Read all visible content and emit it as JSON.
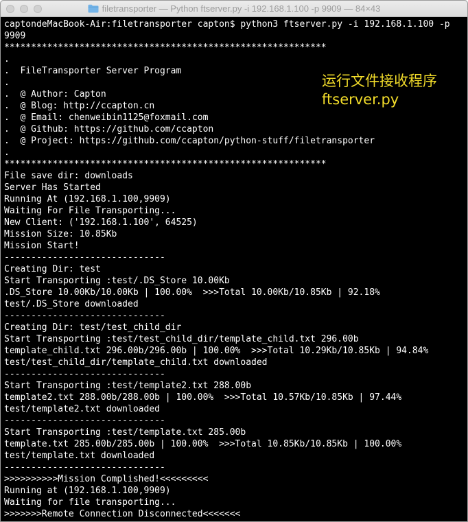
{
  "window": {
    "title": "filetransporter — Python ftserver.py -i 192.168.1.100 -p 9909 — 84×43",
    "colors": {
      "background": "#000000",
      "text": "#ffffff",
      "annotation": "#f2dc2a",
      "titlebar": "#e4e4e4",
      "traffic_inactive": "#d1d1d1",
      "folder_icon": "#74b4e8"
    }
  },
  "terminal": {
    "lines": [
      "captondeMacBook-Air:filetransporter capton$ python3 ftserver.py -i 192.168.1.100 -p",
      "9909",
      "************************************************************",
      ".",
      ".  FileTransporter Server Program",
      ".",
      ".  @ Author: Capton",
      ".  @ Blog: http://ccapton.cn",
      ".  @ Email: chenweibin1125@foxmail.com",
      ".  @ Github: https://github.com/ccapton",
      ".  @ Project: https://github.com/ccapton/python-stuff/filetransporter",
      ".",
      "************************************************************",
      "File save dir: downloads",
      "Server Has Started",
      "Running At (192.168.1.100,9909)",
      "Waiting For File Transporting...",
      "New Client: ('192.168.1.100', 64525)",
      "Mission Size: 10.85Kb",
      "Mission Start!",
      "------------------------------",
      "Creating Dir: test",
      "Start Transporting :test/.DS_Store 10.00Kb",
      ".DS_Store 10.00Kb/10.00Kb | 100.00%  >>>Total 10.00Kb/10.85Kb | 92.18%",
      "test/.DS_Store downloaded",
      "------------------------------",
      "Creating Dir: test/test_child_dir",
      "Start Transporting :test/test_child_dir/template_child.txt 296.00b",
      "template_child.txt 296.00b/296.00b | 100.00%  >>>Total 10.29Kb/10.85Kb | 94.84%",
      "test/test_child_dir/template_child.txt downloaded",
      "------------------------------",
      "Start Transporting :test/template2.txt 288.00b",
      "template2.txt 288.00b/288.00b | 100.00%  >>>Total 10.57Kb/10.85Kb | 97.44%",
      "test/template2.txt downloaded",
      "------------------------------",
      "Start Transporting :test/template.txt 285.00b",
      "template.txt 285.00b/285.00b | 100.00%  >>>Total 10.85Kb/10.85Kb | 100.00%",
      "test/template.txt downloaded",
      "------------------------------",
      ">>>>>>>>>>Mission Complished!<<<<<<<<<",
      "Running at (192.168.1.100,9909)",
      "Waiting for file transporting...",
      ">>>>>>>Remote Connection Disconnected<<<<<<<"
    ]
  },
  "annotation": {
    "line1": "运行文件接收程序",
    "line2": "ftserver.py"
  }
}
